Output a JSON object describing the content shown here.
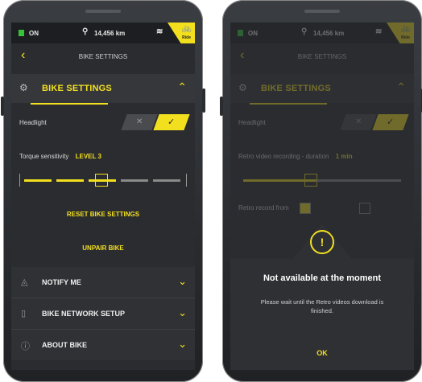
{
  "status": {
    "power": "ON",
    "odometer": "14,456 km",
    "ride_label": "Ride"
  },
  "header": {
    "title": "BIKE SETTINGS"
  },
  "bike_settings": {
    "label": "BIKE SETTINGS",
    "headlight_label": "Headlight",
    "headlight_off_glyph": "✕",
    "headlight_on_glyph": "✓",
    "torque_label": "Torque sensitivity",
    "torque_level": "LEVEL 3",
    "torque_level_value": 3,
    "reset_label": "RESET BIKE SETTINGS",
    "unpair_label": "UNPAIR BIKE"
  },
  "menu": {
    "items": [
      {
        "label": "NOTIFY ME",
        "icon": "bell-icon"
      },
      {
        "label": "BIKE NETWORK SETUP",
        "icon": "device-icon"
      },
      {
        "label": "ABOUT BIKE",
        "icon": "info-icon"
      }
    ]
  },
  "overlay_screen": {
    "retro_label": "Retro video recording - duration",
    "retro_value": "1 min",
    "retro_record_label": "Retro record from"
  },
  "modal": {
    "icon": "warning-icon",
    "title": "Not available at the moment",
    "message": "Please wait until the Retro videos download is finished.",
    "ok_label": "OK"
  },
  "colors": {
    "accent": "#f2e01f",
    "background": "#2b2c30",
    "battery": "#35c435"
  }
}
